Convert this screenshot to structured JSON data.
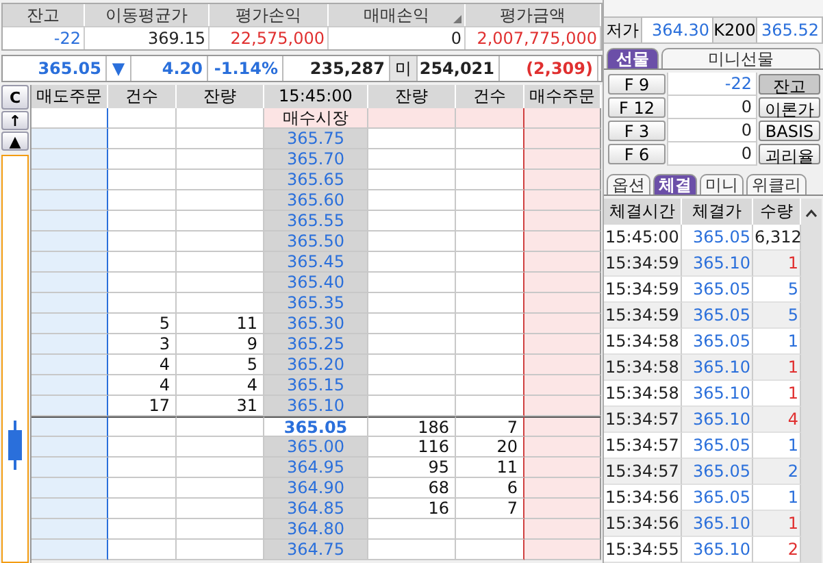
{
  "summary": {
    "columns": [
      "잔고",
      "이동평균가",
      "평가손익",
      "매매손익",
      "평가금액"
    ],
    "values": [
      {
        "text": "-22",
        "color": "#2a6fdb"
      },
      {
        "text": "369.15",
        "color": "#222222"
      },
      {
        "text": "22,575,000",
        "color": "#e03030"
      },
      {
        "text": "0",
        "color": "#222222"
      },
      {
        "text": "2,007,775,000",
        "color": "#e03030"
      }
    ]
  },
  "ticker": {
    "price": "365.05",
    "arrow": "▼",
    "change": "4.20",
    "rate": "-1.14%",
    "volume": "235,287",
    "open_interest_label": "미",
    "open_interest": "254,021",
    "oi_change": "(2,309)"
  },
  "orderbook": {
    "buttons": [
      "C",
      "↑",
      "▲"
    ],
    "columns": [
      "매도주문",
      "건수",
      "잔량",
      "15:45:00",
      "잔량",
      "건수",
      "매수주문"
    ],
    "rows": [
      {
        "kind": "market",
        "label": "매수시장"
      },
      {
        "kind": "price",
        "price": "365.75",
        "current": false
      },
      {
        "kind": "price",
        "price": "365.70",
        "current": false
      },
      {
        "kind": "price",
        "price": "365.65",
        "current": false
      },
      {
        "kind": "price",
        "price": "365.60",
        "current": false
      },
      {
        "kind": "price",
        "price": "365.55",
        "current": false
      },
      {
        "kind": "price",
        "price": "365.50",
        "current": false
      },
      {
        "kind": "price",
        "price": "365.45",
        "current": false
      },
      {
        "kind": "price",
        "price": "365.40",
        "current": false
      },
      {
        "kind": "price",
        "price": "365.35",
        "current": false
      },
      {
        "kind": "price",
        "price": "365.30",
        "current": false,
        "sell_count": "5",
        "sell_qty": "11"
      },
      {
        "kind": "price",
        "price": "365.25",
        "current": false,
        "sell_count": "3",
        "sell_qty": "9"
      },
      {
        "kind": "price",
        "price": "365.20",
        "current": false,
        "sell_count": "4",
        "sell_qty": "5"
      },
      {
        "kind": "price",
        "price": "365.15",
        "current": false,
        "sell_count": "4",
        "sell_qty": "4"
      },
      {
        "kind": "price",
        "price": "365.10",
        "current": false,
        "sell_count": "17",
        "sell_qty": "31"
      },
      {
        "kind": "price",
        "price": "365.05",
        "current": true,
        "buy_qty": "186",
        "buy_count": "7"
      },
      {
        "kind": "price",
        "price": "365.00",
        "current": false,
        "buy_qty": "116",
        "buy_count": "20"
      },
      {
        "kind": "price",
        "price": "364.95",
        "current": false,
        "buy_qty": "95",
        "buy_count": "11"
      },
      {
        "kind": "price",
        "price": "364.90",
        "current": false,
        "buy_qty": "68",
        "buy_count": "6"
      },
      {
        "kind": "price",
        "price": "364.85",
        "current": false,
        "buy_qty": "16",
        "buy_count": "7"
      },
      {
        "kind": "price",
        "price": "364.80",
        "current": false
      },
      {
        "kind": "price",
        "price": "364.75",
        "current": false
      }
    ]
  },
  "quote": {
    "low_label": "저가",
    "low": "364.30",
    "index_label": "K200",
    "index": "365.52"
  },
  "futures_tabs": [
    {
      "label": "선물",
      "selected": true
    },
    {
      "label": "미니선물",
      "selected": false
    }
  ],
  "futures": [
    {
      "label": "F 9",
      "value": "-22",
      "button": "잔고",
      "selected": true
    },
    {
      "label": "F 12",
      "value": "0",
      "button": "이론가",
      "selected": false
    },
    {
      "label": "F 3",
      "value": "0",
      "button": "BASIS",
      "selected": false
    },
    {
      "label": "F 6",
      "value": "0",
      "button": "괴리율",
      "selected": false
    }
  ],
  "trade_tabs": [
    {
      "label": "옵션",
      "selected": false
    },
    {
      "label": "체결",
      "selected": true
    },
    {
      "label": "미니",
      "selected": false
    },
    {
      "label": "위클리",
      "selected": false
    }
  ],
  "trades": {
    "columns": [
      "체결시간",
      "체결가",
      "수량"
    ],
    "rows": [
      {
        "time": "15:45:00",
        "price": "365.05",
        "qty": "6,312",
        "color": "#222222"
      },
      {
        "time": "15:34:59",
        "price": "365.10",
        "qty": "1",
        "color": "#e03030"
      },
      {
        "time": "15:34:59",
        "price": "365.05",
        "qty": "5",
        "color": "#2a6fdb"
      },
      {
        "time": "15:34:59",
        "price": "365.05",
        "qty": "5",
        "color": "#2a6fdb"
      },
      {
        "time": "15:34:58",
        "price": "365.05",
        "qty": "1",
        "color": "#2a6fdb"
      },
      {
        "time": "15:34:58",
        "price": "365.10",
        "qty": "1",
        "color": "#e03030"
      },
      {
        "time": "15:34:58",
        "price": "365.10",
        "qty": "1",
        "color": "#e03030"
      },
      {
        "time": "15:34:57",
        "price": "365.10",
        "qty": "4",
        "color": "#e03030"
      },
      {
        "time": "15:34:57",
        "price": "365.05",
        "qty": "1",
        "color": "#2a6fdb"
      },
      {
        "time": "15:34:57",
        "price": "365.05",
        "qty": "2",
        "color": "#2a6fdb"
      },
      {
        "time": "15:34:56",
        "price": "365.05",
        "qty": "1",
        "color": "#2a6fdb"
      },
      {
        "time": "15:34:56",
        "price": "365.10",
        "qty": "1",
        "color": "#e03030"
      },
      {
        "time": "15:34:55",
        "price": "365.10",
        "qty": "2",
        "color": "#e03030"
      }
    ]
  }
}
